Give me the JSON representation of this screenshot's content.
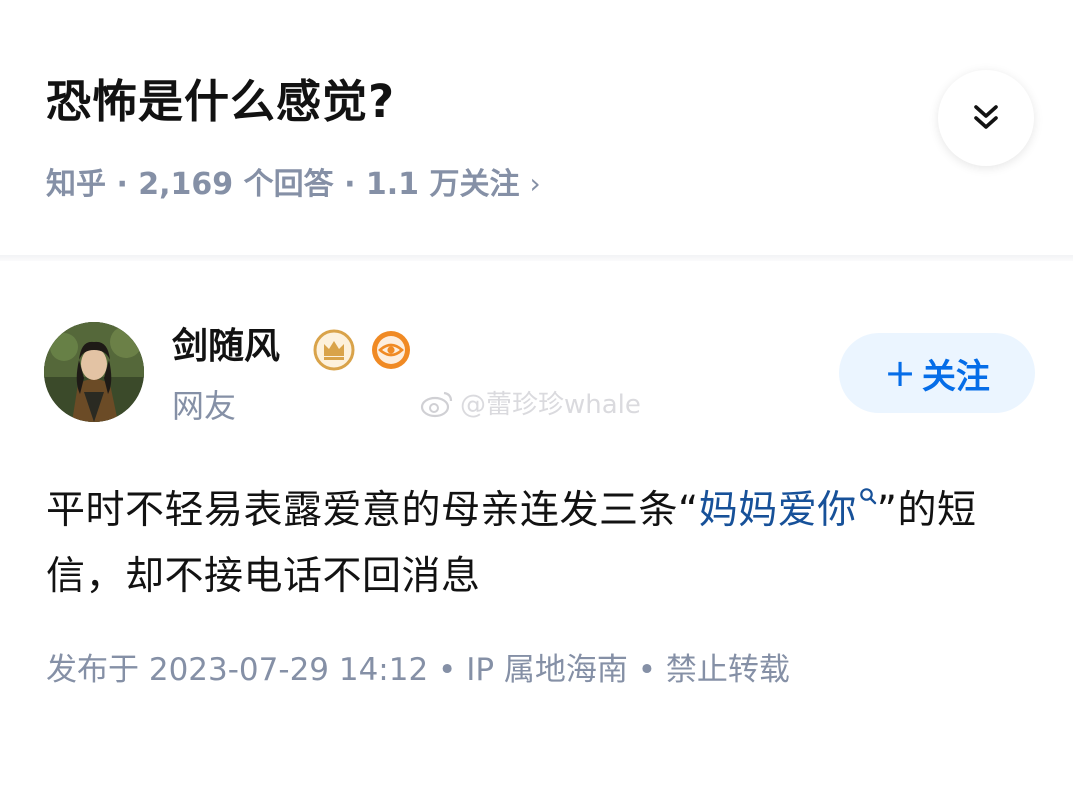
{
  "question": {
    "title": "恐怖是什么感觉?",
    "meta": "知乎 · 2,169 个回答 · 1.1 万关注",
    "meta_icon": "chevron-right-icon",
    "collapse_icon": "double-chevron-down-icon"
  },
  "answer": {
    "author": {
      "name": "剑随风",
      "headline": "网友",
      "badges": [
        "crown-badge-icon",
        "eye-badge-icon"
      ]
    },
    "follow_button": {
      "label": "关注",
      "icon": "plus-icon"
    },
    "watermark": "@蕾珍珍whale",
    "content": {
      "before": "平时不轻易表露爱意的母亲连发三条“",
      "link": "妈妈爱你",
      "after": "”的短信，却不接电话不回消息"
    },
    "meta": "发布于 2023-07-29 14:12 • IP 属地海南 • 禁止转载"
  },
  "colors": {
    "primary_text": "#121212",
    "secondary_text": "#8590a6",
    "link": "#175199",
    "follow_button_bg": "#ebf5ff",
    "follow_button_text": "#056de8",
    "badge_gold": "#d9a34a",
    "badge_orange": "#f08a24"
  }
}
